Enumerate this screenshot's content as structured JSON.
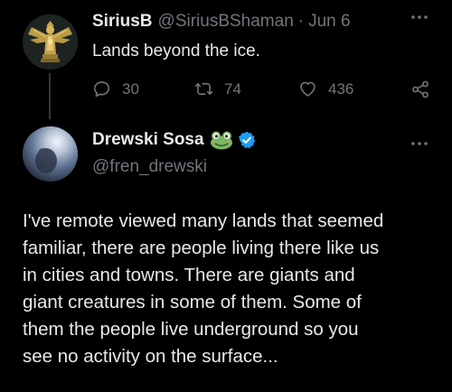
{
  "tweet1": {
    "display_name": "SiriusB",
    "handle": "@SiriusBShaman",
    "separator": "·",
    "date": "Jun 6",
    "text": "Lands beyond the ice.",
    "replies": "30",
    "retweets": "74",
    "likes": "436",
    "avatar_icon": "golden-idol-avatar"
  },
  "tweet2": {
    "display_name": "Drewski Sosa",
    "emoji": "frog-emoji",
    "badge": "verified-badge",
    "handle": "@fren_drewski",
    "text": "I've remote viewed many lands that seemed\nfamiliar, there are people living there like us\nin cities and towns. There are giants and\ngiant creatures in some of them. Some of\nthem the people live underground so you\nsee no activity on the surface...",
    "avatar_icon": "moon-avatar"
  },
  "colors": {
    "background": "#000000",
    "text": "#e7e9ea",
    "muted": "#71767b",
    "verified": "#1d9bf0"
  }
}
